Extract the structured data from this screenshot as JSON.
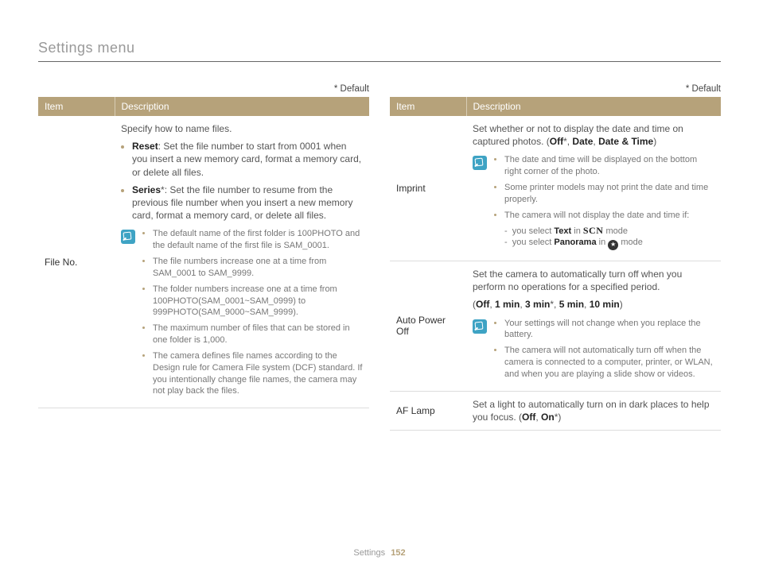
{
  "page_title": "Settings menu",
  "default_note": "* Default",
  "headers": {
    "item": "Item",
    "desc": "Description"
  },
  "footer": {
    "section": "Settings",
    "page": "152"
  },
  "left": {
    "file_no": {
      "label": "File No.",
      "intro": "Specify how to name files.",
      "reset": {
        "title": "Reset",
        "text": ": Set the file number to start from 0001 when you insert a new memory card, format a memory card, or delete all files."
      },
      "series": {
        "title": "Series",
        "star": "*",
        "text": ": Set the file number to resume from the previous file number when you insert a new memory card, format a memory card, or delete all files."
      },
      "notes": [
        "The default name of the first folder is 100PHOTO and the default name of the first file is SAM_0001.",
        "The file numbers increase one at a time from SAM_0001 to SAM_9999.",
        "The folder numbers increase one at a time from 100PHOTO(SAM_0001~SAM_0999) to 999PHOTO(SAM_9000~SAM_9999).",
        "The maximum number of files that can be stored in one folder is 1,000.",
        "The camera defines file names according to the Design rule for Camera File system (DCF) standard. If you intentionally change file names, the camera may not play back the files."
      ]
    }
  },
  "right": {
    "imprint": {
      "label": "Imprint",
      "desc_pre": "Set whether or not to display the date and time on captured photos. (",
      "off": "Off",
      "star": "*",
      "c1": ", ",
      "date": "Date",
      "c2": ", ",
      "datetime": "Date & Time",
      "paren_end": ")",
      "notes_0": "The date and time will be displayed on the bottom right corner of the photo.",
      "notes_1": "Some printer models may not print the date and time properly.",
      "notes_2": "The camera will not display the date and time if:",
      "sub_text_pre": "you select ",
      "sub_text_word": "Text",
      "sub_text_post": " in ",
      "sub_text_post2": " mode",
      "sub_pano_pre": "you select ",
      "sub_pano_word": "Panorama",
      "sub_pano_post": " in ",
      "sub_pano_post2": " mode",
      "scn": "SCN"
    },
    "autoPower": {
      "label": "Auto Power Off",
      "desc_line": "Set the camera to automatically turn off when you perform no operations for a specified period.",
      "opts_open": "(",
      "o0": "Off",
      "c": ", ",
      "o1": "1 min",
      "o2": "3 min",
      "star": "*",
      "o3": "5 min",
      "o4": "10 min",
      "opts_close": ")",
      "notes": [
        "Your settings will not change when you replace the battery.",
        "The camera will not automatically turn off when the camera is connected to a computer, printer, or WLAN, and when you are playing a slide show or videos."
      ]
    },
    "afLamp": {
      "label": "AF Lamp",
      "desc_pre": "Set a light to automatically turn on in dark places to help you focus. (",
      "off": "Off",
      "comma": ", ",
      "on": "On",
      "star": "*",
      "paren_end": ")"
    }
  }
}
